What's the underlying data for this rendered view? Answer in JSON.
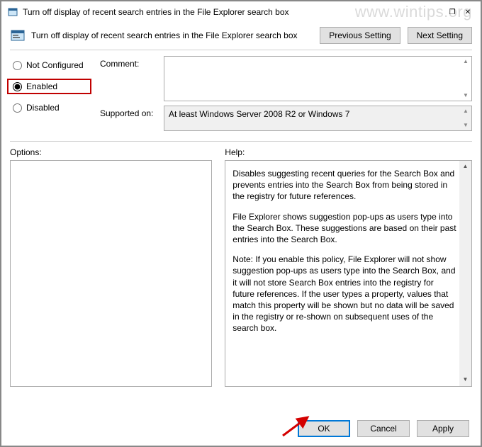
{
  "watermark": "www.wintips.org",
  "title": "Turn off display of recent search entries in the File Explorer search box",
  "header_title": "Turn off display of recent search entries in the File Explorer search box",
  "nav": {
    "previous": "Previous Setting",
    "next": "Next Setting"
  },
  "radios": {
    "not_configured": "Not Configured",
    "enabled": "Enabled",
    "disabled": "Disabled",
    "selected": "enabled"
  },
  "labels": {
    "comment": "Comment:",
    "supported": "Supported on:",
    "options": "Options:",
    "help": "Help:"
  },
  "supported_text": "At least Windows Server 2008 R2 or Windows 7",
  "help_paragraphs": [
    "Disables suggesting recent queries for the Search Box and prevents entries into the Search Box from being stored in the registry for future references.",
    "File Explorer shows suggestion pop-ups as users type into the Search Box.  These suggestions are based on their past entries into the Search Box.",
    "Note: If you enable this policy, File Explorer will not show suggestion pop-ups as users type into the Search Box, and it will not store Search Box entries into the registry for future references.  If the user types a property, values that match this property will be shown but no data will be saved in the registry or re-shown on subsequent uses of the search box."
  ],
  "buttons": {
    "ok": "OK",
    "cancel": "Cancel",
    "apply": "Apply"
  }
}
